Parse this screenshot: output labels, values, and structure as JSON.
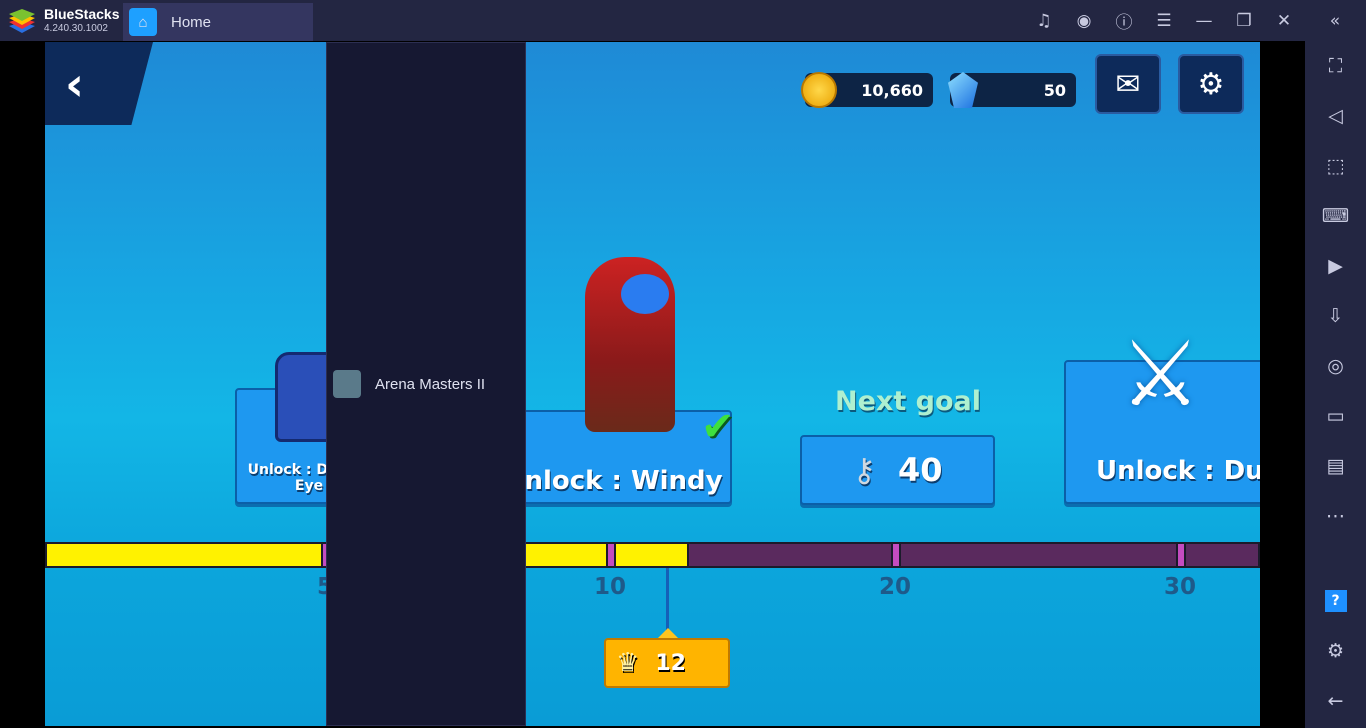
{
  "titlebar": {
    "brand": "BlueStacks",
    "version": "4.240.30.1002",
    "tabs": [
      {
        "label": "Home"
      },
      {
        "label": "Arena Masters II"
      }
    ],
    "icons": [
      "bell-icon",
      "account-icon",
      "help-icon",
      "menu-icon",
      "minimize-icon",
      "restore-icon",
      "close-icon",
      "collapse-icon"
    ]
  },
  "game": {
    "gold": "10,660",
    "gems": "50",
    "rewards": [
      {
        "label": "Unlock : Dora & Mad Eye Skin",
        "claimed": true
      },
      {
        "label": "Unlock : Windy",
        "claimed": true
      },
      {
        "label": "Unlock : Dua",
        "claimed": false
      }
    ],
    "next_goal": {
      "title": "Next goal",
      "value": "40"
    },
    "progress": {
      "current": 12,
      "ticks": [
        "5",
        "10",
        "20",
        "30"
      ]
    },
    "trophies": "12"
  },
  "colors": {
    "fill": "#fff200",
    "empty": "#5a2a5e",
    "tick": "#c44cc0"
  },
  "sidebar": {
    "icons": [
      "fullscreen-icon",
      "volume-icon",
      "select-icon",
      "keyboard-icon",
      "media-icon",
      "apk-icon",
      "screenshot-icon",
      "record-icon",
      "folder-icon",
      "more-icon",
      "help-icon",
      "settings-icon",
      "back-icon"
    ]
  }
}
